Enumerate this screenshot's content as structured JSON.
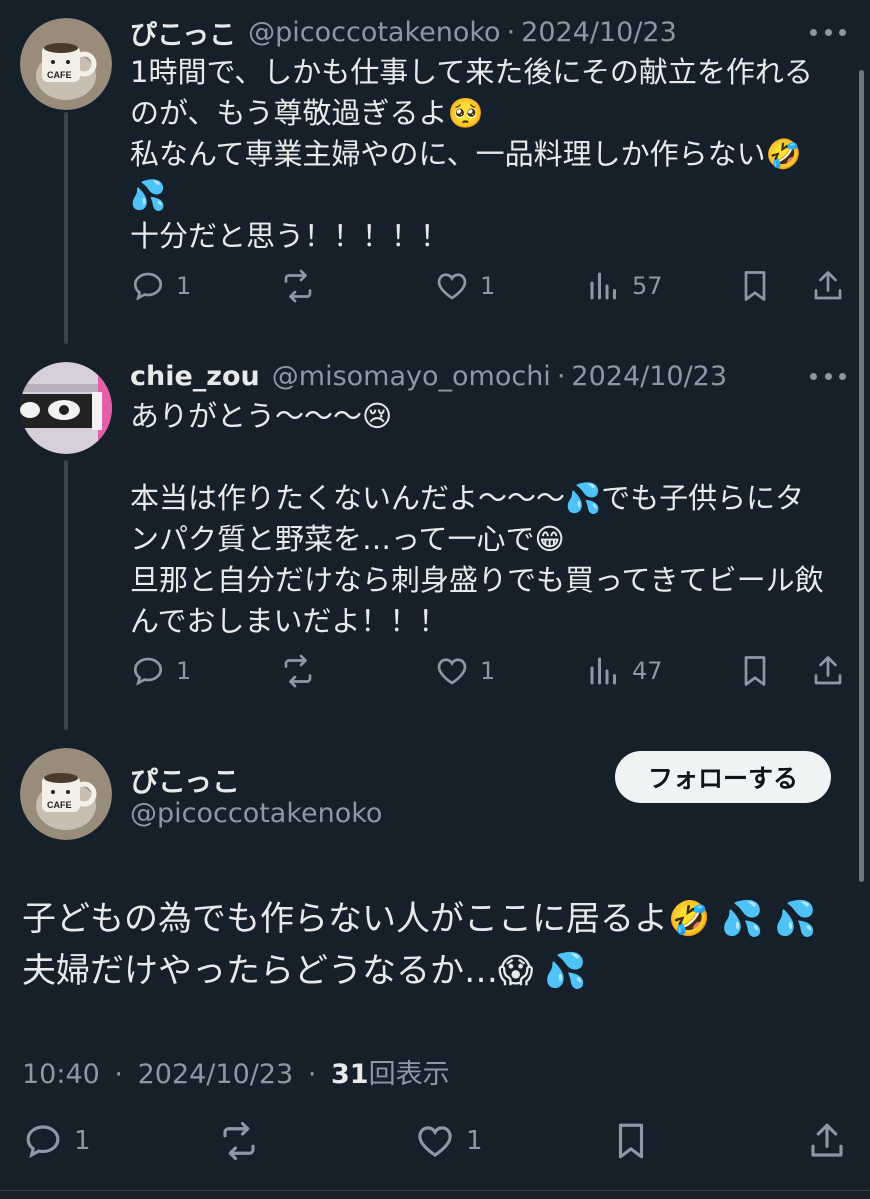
{
  "tweets": [
    {
      "name": "ぴこっこ",
      "handle": "@picoccotakenoko",
      "sep": "·",
      "date": "2024/10/23",
      "lines": [
        "1時間で、しかも仕事して来た後にその献立を作れる",
        "のが、もう尊敬過ぎるよ🥺",
        "私なんて専業主婦やのに、一品料理しか作らない🤣",
        "💦",
        "十分だと思う！！！！！"
      ],
      "reply_count": "1",
      "like_count": "1",
      "view_count": "57"
    },
    {
      "name": "chie_zou",
      "handle": "@misomayo_omochi",
      "sep": "·",
      "date": "2024/10/23",
      "lines": [
        "ありがとう〜〜〜😢",
        "",
        "本当は作りたくないんだよ〜〜〜💦でも子供らにタ",
        "ンパク質と野菜を…って一心で😁",
        "旦那と自分だけなら刺身盛りでも買ってきてビール飲",
        "んでおしまいだよ！！！"
      ],
      "reply_count": "1",
      "like_count": "1",
      "view_count": "47"
    }
  ],
  "main_post": {
    "name": "ぴこっこ",
    "handle": "@picoccotakenoko",
    "follow_label": "フォローする",
    "lines": [
      "子どもの為でも作らない人がここに居るよ🤣 💦 💦",
      "夫婦だけやったらどうなるか…😱 💦"
    ],
    "time": "10:40",
    "sep": "·",
    "date": "2024/10/23",
    "views": "31",
    "views_suffix": "回表示",
    "reply_count": "1",
    "like_count": "1"
  },
  "icons": {
    "reply": "reply-icon",
    "retweet": "retweet-icon",
    "like": "heart-icon",
    "views": "views-icon",
    "bookmark": "bookmark-icon",
    "share": "share-icon",
    "more": "more-icon"
  },
  "colors": {
    "background": "#15202b",
    "text": "#e7e9ea",
    "secondary": "#8b98a5",
    "line": "#38444d",
    "button": "#eff3f4"
  }
}
